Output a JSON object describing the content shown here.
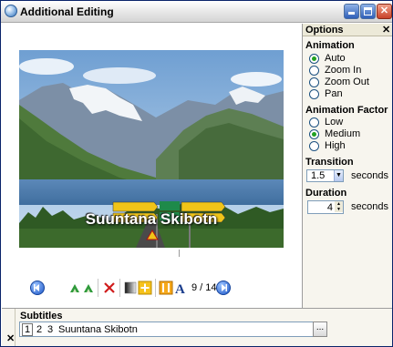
{
  "window": {
    "title": "Additional Editing",
    "controls": {
      "minimize": "",
      "maximize": "",
      "close": "✕"
    }
  },
  "photo": {
    "caption": "Suuntana Skibotn",
    "road_signs": [
      "Narvik",
      "Kvesnes",
      "Tromsø",
      "Skibotn",
      "E6",
      "E8",
      "E6"
    ]
  },
  "toolbar": {
    "counter": "9 / 14",
    "buttons": [
      "prev",
      "rotate-left",
      "rotate-right",
      "delete",
      "adjust",
      "add-effect",
      "crop",
      "text",
      "next"
    ]
  },
  "options": {
    "title": "Options",
    "close": "✕",
    "animation": {
      "title": "Animation",
      "items": [
        "Auto",
        "Zoom In",
        "Zoom Out",
        "Pan"
      ],
      "selected": "Auto"
    },
    "animation_factor": {
      "title": "Animation Factor",
      "items": [
        "Low",
        "Medium",
        "High"
      ],
      "selected": "Medium"
    },
    "transition": {
      "title": "Transition",
      "value": "1.5",
      "unit": "seconds"
    },
    "duration": {
      "title": "Duration",
      "value": "4",
      "unit": "seconds"
    }
  },
  "subtitles": {
    "title": "Subtitles",
    "close": "✕",
    "numbers": [
      "1",
      "2",
      "3"
    ],
    "selected": "1",
    "text": "Suuntana Skibotn",
    "more_label": "..."
  },
  "colors": {
    "accent": "#1d57c8",
    "radio_selected": "#21a121",
    "panel_bg": "#f7f5ee"
  }
}
